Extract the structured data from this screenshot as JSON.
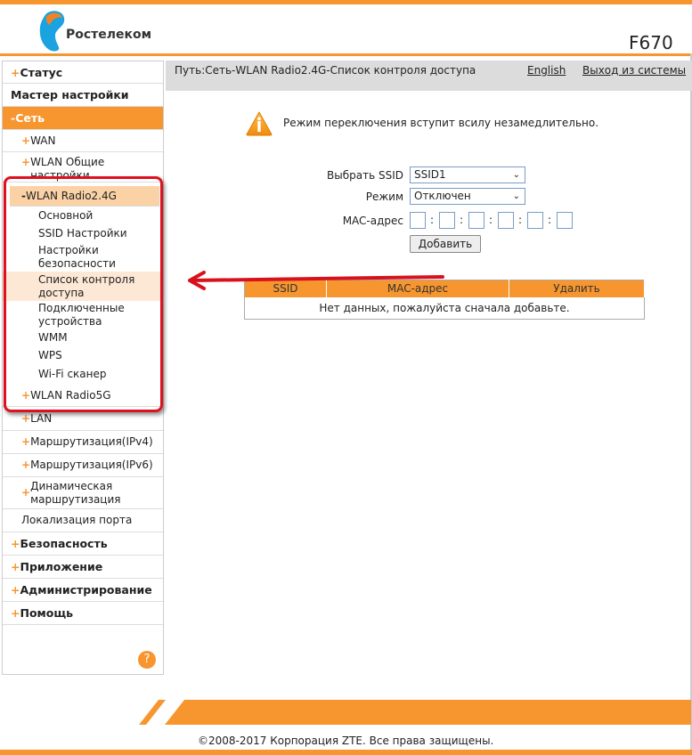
{
  "header": {
    "brand": "Ростелеком",
    "model": "F670",
    "brand_colors": {
      "accent": "#f7962f",
      "logo_blue": "#1aa3e0",
      "logo_orange": "#f58220"
    }
  },
  "topnav": {
    "path": "Путь:Сеть-WLAN Radio2.4G-Список контроля доступа",
    "english": "English",
    "logout": "Выход из системы"
  },
  "sidebar": {
    "items": [
      {
        "label": "Статус",
        "prefix": "+",
        "level": 1
      },
      {
        "label": "Мастер настройки",
        "prefix": "",
        "level": 1
      },
      {
        "label": "Сеть",
        "prefix": "-",
        "level": 1,
        "active": true
      },
      {
        "label": "WAN",
        "prefix": "+",
        "level": 2
      },
      {
        "label": "WLAN Общие настройки",
        "prefix": "+",
        "level": 2
      },
      {
        "label": "WLAN Radio2.4G",
        "prefix": "-",
        "level": 2,
        "active": true
      },
      {
        "label": "Основной",
        "prefix": "",
        "level": 3
      },
      {
        "label": "SSID Настройки",
        "prefix": "",
        "level": 3
      },
      {
        "label": "Настройки безопасности",
        "prefix": "",
        "level": 3
      },
      {
        "label": "Список контроля доступа",
        "prefix": "",
        "level": 3,
        "active": true
      },
      {
        "label": "Подключенные устройства",
        "prefix": "",
        "level": 3
      },
      {
        "label": "WMM",
        "prefix": "",
        "level": 3
      },
      {
        "label": "WPS",
        "prefix": "",
        "level": 3
      },
      {
        "label": "Wi-Fi сканер",
        "prefix": "",
        "level": 3
      },
      {
        "label": "WLAN Radio5G",
        "prefix": "+",
        "level": 2
      },
      {
        "label": "LAN",
        "prefix": "+",
        "level": 2
      },
      {
        "label": "Маршрутизация(IPv4)",
        "prefix": "+",
        "level": 2
      },
      {
        "label": "Маршрутизация(IPv6)",
        "prefix": "+",
        "level": 2
      },
      {
        "label": "Динамическая маршрутизация",
        "prefix": "+",
        "level": 2
      },
      {
        "label": "Локализация порта",
        "prefix": "",
        "level": 2
      },
      {
        "label": "Безопасность",
        "prefix": "+",
        "level": 1
      },
      {
        "label": "Приложение",
        "prefix": "+",
        "level": 1
      },
      {
        "label": "Администрирование",
        "prefix": "+",
        "level": 1
      },
      {
        "label": "Помощь",
        "prefix": "+",
        "level": 1
      }
    ],
    "help_icon": "question-icon",
    "help_glyph": "?"
  },
  "main": {
    "notice": "Режим переключения вступит всилу незамедлительно.",
    "notice_icon": "warning-icon",
    "ssid_label": "Выбрать SSID",
    "ssid_value": "SSID1",
    "mode_label": "Режим",
    "mode_value": "Отключен",
    "mac_label": "MAC-адрес",
    "mac_values": [
      "",
      "",
      "",
      "",
      "",
      ""
    ],
    "add_button": "Добавить",
    "table": {
      "headers": [
        "SSID",
        "MAC-адрес",
        "Удалить"
      ],
      "empty": "Нет данных, пожалуйста сначала добавьте."
    }
  },
  "footer": {
    "copyright": "©2008-2017 Корпорация ZTE. Все права защищены."
  }
}
